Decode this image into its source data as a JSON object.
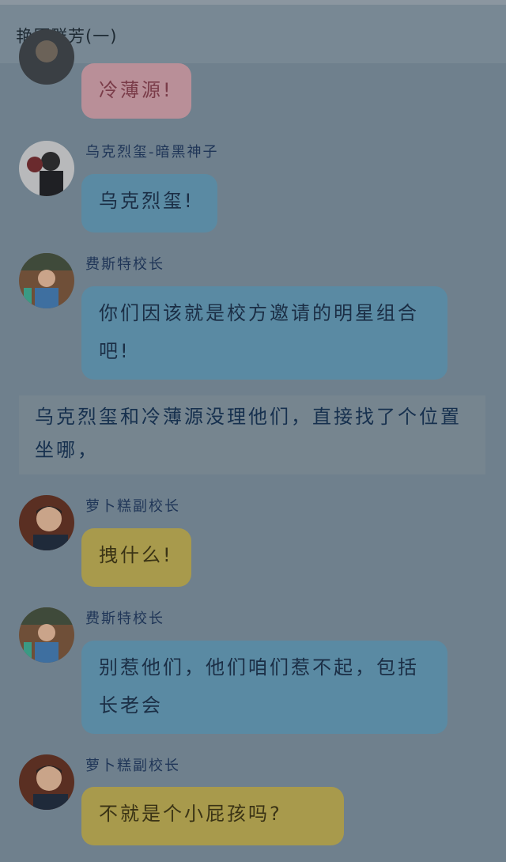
{
  "header": {
    "title": "艳压群芳(一)"
  },
  "messages": [
    {
      "sender": "",
      "text": "冷薄源!",
      "color": "pink"
    },
    {
      "sender": "乌克烈玺-暗黑神子",
      "text": "乌克烈玺!",
      "color": "blue"
    },
    {
      "sender": "费斯特校长",
      "text": "你们因该就是校方邀请的明星组合吧!",
      "color": "blue"
    },
    {
      "sender": "萝卜糕副校长",
      "text": "拽什么!",
      "color": "yellow"
    },
    {
      "sender": "费斯特校长",
      "text": "别惹他们，他们咱们惹不起，包括长老会",
      "color": "blue"
    },
    {
      "sender": "萝卜糕副校长",
      "text": "不就是个小屁孩吗?",
      "color": "yellow"
    }
  ],
  "narration": {
    "text": "乌克烈玺和冷薄源没理他们，直接找了个位置坐哪，"
  },
  "avatars": {
    "partial": "avatar-icon",
    "wukelie": "avatar-icon",
    "feisite": "avatar-icon",
    "luobogao": "avatar-icon"
  }
}
